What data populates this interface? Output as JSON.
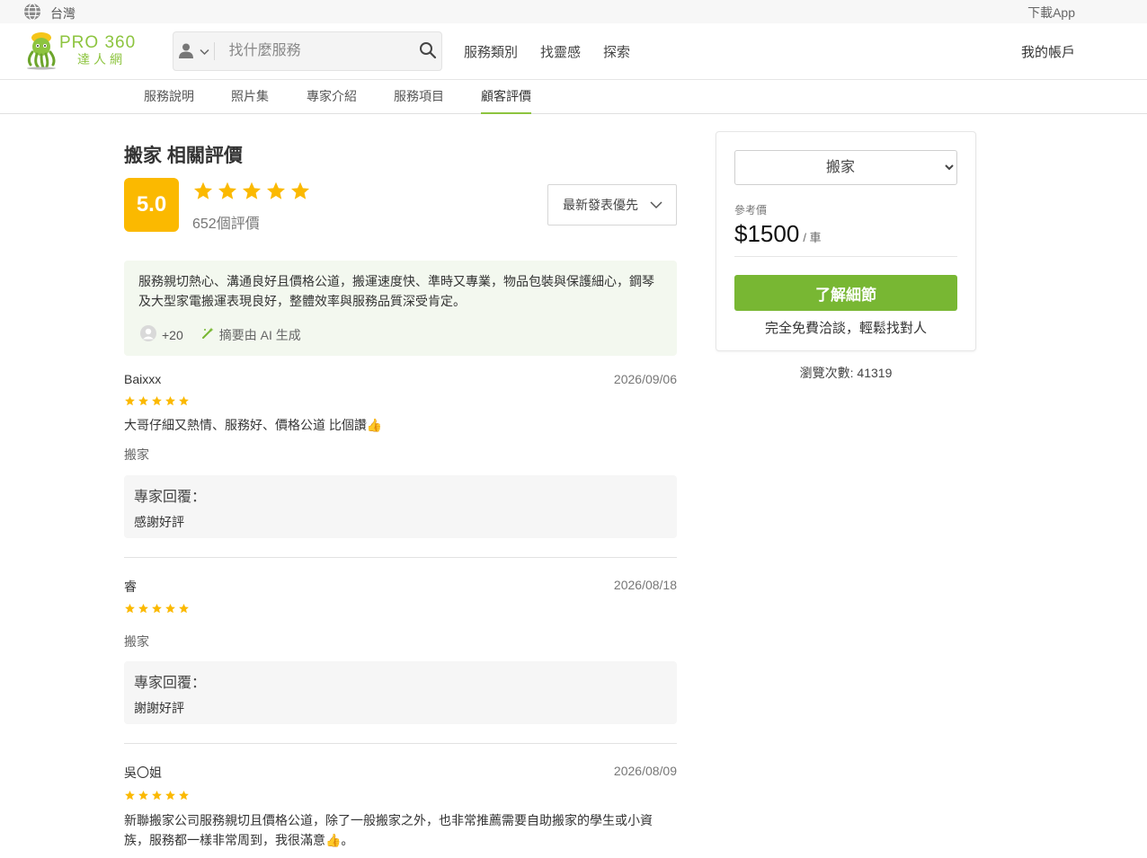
{
  "topbar": {
    "region": "台灣",
    "download": "下載App"
  },
  "header": {
    "logo_brand": "PRO 360",
    "logo_sub": "達人網",
    "search_placeholder": "找什麼服務",
    "nav": [
      "服務類別",
      "找靈感",
      "探索"
    ],
    "account": "我的帳戶"
  },
  "subtabs": [
    "服務說明",
    "照片集",
    "專家介紹",
    "服務項目",
    "顧客評價"
  ],
  "reviews_section": {
    "title": "搬家 相關評價",
    "score": "5.0",
    "rating_stars": 5,
    "count": "652個評價",
    "sort": "最新發表優先",
    "ai_summary": "服務親切熱心、溝通良好且價格公道，搬運速度快、準時又專業，物品包裝與保護細心，鋼琴及大型家電搬運表現良好，整體效率與服務品質深受肯定。",
    "ai_count": "+20",
    "ai_label": "摘要由 AI 生成"
  },
  "reviews": [
    {
      "name": "Baixxx",
      "date": "2026/09/06",
      "stars": 5,
      "comment": " 大哥仔細又熱情、服務好、價格公道 比個讚👍",
      "service": "搬家",
      "reply_label": "專家回覆：",
      "reply": "感謝好評"
    },
    {
      "name": "睿",
      "date": "2026/08/18",
      "stars": 5,
      "comment": "",
      "service": "搬家",
      "reply_label": "專家回覆：",
      "reply": "謝謝好評"
    },
    {
      "name": "吳〇姐",
      "date": "2026/08/09",
      "stars": 5,
      "comment": " 新聯搬家公司服務親切且價格公道，除了一般搬家之外，也非常推薦需要自助搬家的學生或小資族，服務都一樣非常周到，我很滿意👍。"
    }
  ],
  "panel": {
    "service_option": "搬家",
    "ref_label": "參考價",
    "price": "$1500",
    "unit": "/ 車",
    "cta": "了解細節",
    "note": "完全免費洽談，輕鬆找對人"
  },
  "views": "瀏覽次數: 41319",
  "colors": {
    "brand_green": "#8dc43f",
    "cta_green": "#78b733",
    "star_gold": "#fbb900",
    "summary_bg": "#f3f8ef"
  },
  "icons": [
    "globe-icon",
    "user-icon",
    "chevron-down-icon",
    "search-icon",
    "star-icon",
    "avatar-icon",
    "magic-wand-icon"
  ]
}
